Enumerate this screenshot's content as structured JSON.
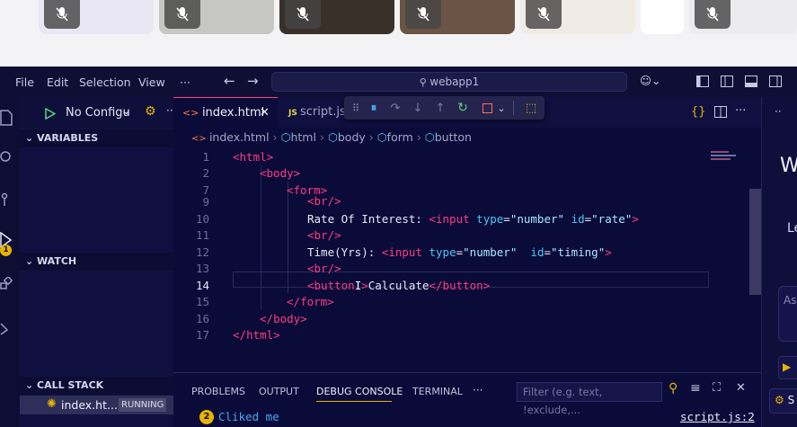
{
  "menu": [
    "File",
    "Edit",
    "Selection",
    "View",
    "···"
  ],
  "command_center": {
    "label": "webapp1"
  },
  "run": {
    "config": "No Configu"
  },
  "sidebar": {
    "variables": "VARIABLES",
    "watch": "WATCH",
    "call_stack": "CALL STACK",
    "stack_item": "index.ht...",
    "stack_status": "RUNNING",
    "badge": "1"
  },
  "tabs": [
    {
      "label": "index.html",
      "active": true
    },
    {
      "label": "script.js",
      "active": false
    }
  ],
  "breadcrumb": [
    "index.html",
    "html",
    "body",
    "form",
    "button"
  ],
  "code_lines": [
    {
      "n": "1"
    },
    {
      "n": "2"
    },
    {
      "n": "7"
    },
    {
      "n": "9"
    },
    {
      "n": "10"
    },
    {
      "n": "11"
    },
    {
      "n": "12"
    },
    {
      "n": "13"
    },
    {
      "n": "14"
    },
    {
      "n": "15"
    },
    {
      "n": "16"
    },
    {
      "n": "17"
    }
  ],
  "code": {
    "l1": "<html>",
    "l2": "<body>",
    "l7": "<form>",
    "l9": "<br/>",
    "l10_text": "Rate Of Interest: ",
    "l10_tag": "input",
    "l10_attr1": "type",
    "l10_val1": "\"number\"",
    "l10_attr2": "id",
    "l10_val2": "\"rate\"",
    "l11": "<br/>",
    "l12_text": "Time(Yrs): ",
    "l12_tag": "input",
    "l12_attr1": "type",
    "l12_val1": "\"number\"",
    "l12_attr2": "id",
    "l12_val2": "\"timing\"",
    "l13": "<br/>",
    "l14_open": "button",
    "l14_text": "Calculate",
    "l14_close": "button",
    "l15": "form",
    "l16": "body",
    "l17": "html"
  },
  "panel": {
    "tabs": [
      "PROBLEMS",
      "OUTPUT",
      "DEBUG CONSOLE",
      "TERMINAL",
      "···"
    ],
    "active_tab": "DEBUG CONSOLE",
    "filter_placeholder": "Filter (e.g. text, !exclude,...",
    "console_count": "2",
    "console_msg": "Cliked me",
    "console_src": "script.js:2"
  },
  "right_pane": {
    "w": "W",
    "le": "Le",
    "ask": "Ask",
    "s": "S"
  },
  "colors": {
    "tag": "#ff3d7f",
    "attr": "#45c8f0",
    "accent": "#e8b400",
    "bg": "#0b0b3a"
  }
}
